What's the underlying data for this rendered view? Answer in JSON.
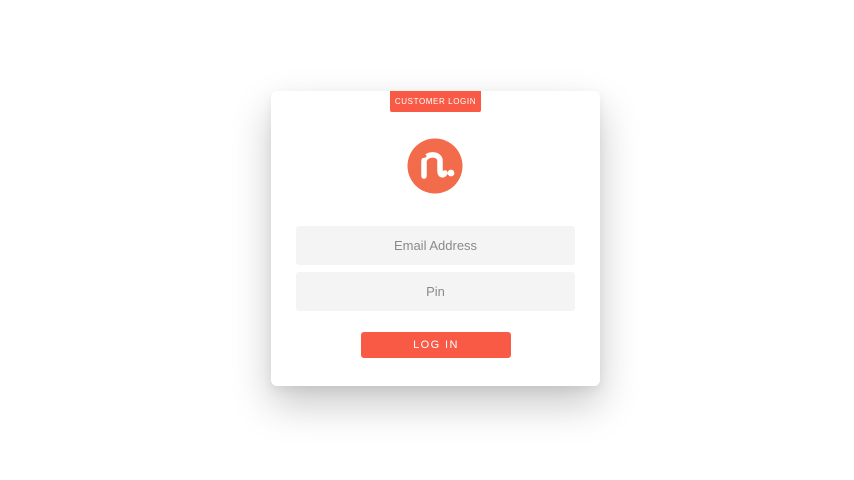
{
  "login_card": {
    "badge_label": "CUSTOMER LOGIN",
    "logo_icon": "brand-logo-icon",
    "email_placeholder": "Email Address",
    "email_value": "",
    "pin_placeholder": "Pin",
    "pin_value": "",
    "login_button_label": "LOG IN"
  },
  "colors": {
    "accent": "#f95a46",
    "field_background": "#f4f4f4",
    "card_background": "#ffffff"
  }
}
